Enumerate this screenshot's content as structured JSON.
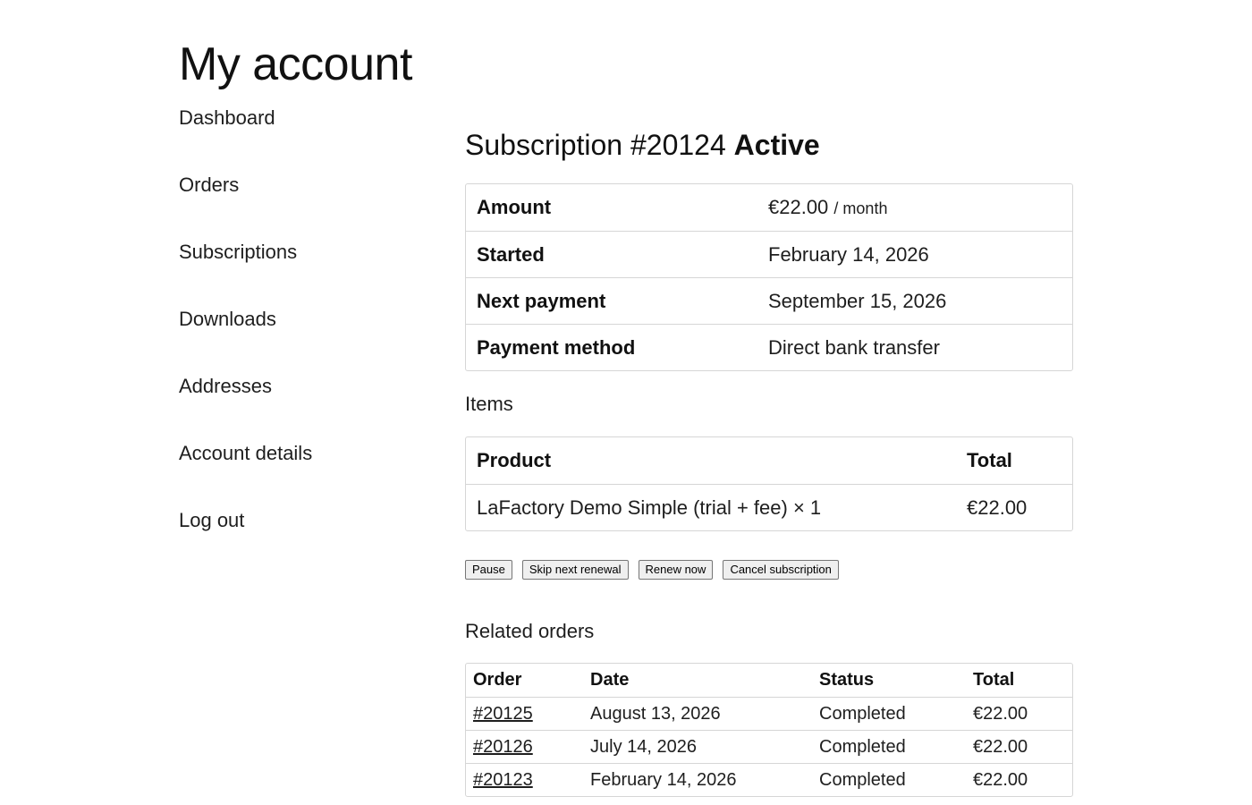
{
  "page": {
    "title": "My account"
  },
  "nav": [
    {
      "label": "Dashboard"
    },
    {
      "label": "Orders"
    },
    {
      "label": "Subscriptions"
    },
    {
      "label": "Downloads"
    },
    {
      "label": "Addresses"
    },
    {
      "label": "Account details"
    },
    {
      "label": "Log out"
    }
  ],
  "subscription": {
    "title": "Subscription #20124",
    "status": "Active",
    "details": [
      {
        "label": "Amount",
        "value": "€22.00",
        "suffix": "/ month"
      },
      {
        "label": "Started",
        "value": "February 14, 2026"
      },
      {
        "label": "Next payment",
        "value": "September 15, 2026"
      },
      {
        "label": "Payment method",
        "value": "Direct bank transfer"
      }
    ]
  },
  "items": {
    "heading": "Items",
    "headers": {
      "product": "Product",
      "total": "Total"
    },
    "rows": [
      {
        "product": "LaFactory Demo Simple (trial + fee) × 1",
        "total": "€22.00"
      }
    ]
  },
  "actions": {
    "pause": "Pause",
    "skip": "Skip next renewal",
    "renew": "Renew now",
    "cancel": "Cancel subscription"
  },
  "related": {
    "heading": "Related orders",
    "headers": {
      "order": "Order",
      "date": "Date",
      "status": "Status",
      "total": "Total"
    },
    "rows": [
      {
        "order": "#20125",
        "date": "August 13, 2026",
        "status": "Completed",
        "total": "€22.00"
      },
      {
        "order": "#20126",
        "date": "July 14, 2026",
        "status": "Completed",
        "total": "€22.00"
      },
      {
        "order": "#20123",
        "date": "February 14, 2026",
        "status": "Completed",
        "total": "€22.00"
      }
    ]
  }
}
